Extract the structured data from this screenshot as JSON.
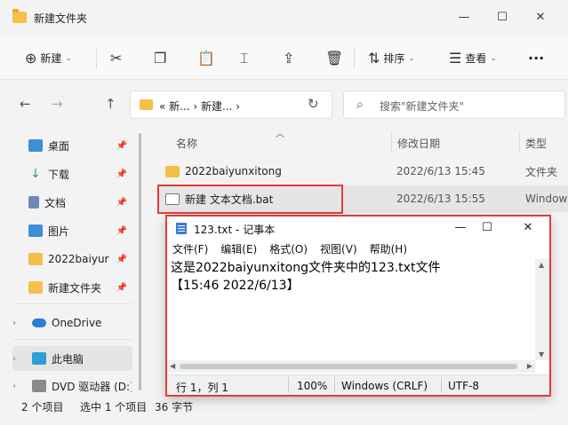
{
  "window": {
    "title": "新建文件夹",
    "minimize": "—",
    "maximize": "☐",
    "close": "✕"
  },
  "toolbar": {
    "new_label": "新建",
    "sort_label": "排序",
    "view_label": "查看",
    "more_label": "···"
  },
  "nav": {
    "back": "←",
    "forward": "→",
    "up": "↑",
    "address": "«  新...  ›  新建...  ›",
    "refresh": "↻",
    "search_placeholder": "搜索\"新建文件夹\""
  },
  "sidebar": {
    "items": [
      {
        "label": "桌面",
        "icon": "desktop-icon",
        "color": "#3c8fd6"
      },
      {
        "label": "下载",
        "icon": "download-icon",
        "color": "#2c9f6b"
      },
      {
        "label": "文档",
        "icon": "document-icon",
        "color": "#6f88b8"
      },
      {
        "label": "图片",
        "icon": "picture-icon",
        "color": "#3c8fd6"
      },
      {
        "label": "2022baiyur",
        "icon": "folder-icon",
        "color": "#f4c04a"
      },
      {
        "label": "新建文件夹",
        "icon": "folder-icon",
        "color": "#f4c04a"
      }
    ],
    "onedrive": "OneDrive",
    "thispc": "此电脑",
    "dvd": "DVD 驱动器 (D:)"
  },
  "filelist": {
    "columns": {
      "name": "名称",
      "date": "修改日期",
      "type": "类型"
    },
    "rows": [
      {
        "name": "2022baiyunxitong",
        "date": "2022/6/13 15:45",
        "type": "文件夹"
      },
      {
        "name": "新建 文本文档.bat",
        "date": "2022/6/13 15:55",
        "type": "Windows"
      }
    ]
  },
  "statusbar": {
    "count": "2 个项目",
    "selected": "选中 1 个项目",
    "size": "36 字节"
  },
  "notepad": {
    "title": "123.txt - 记事本",
    "menu": [
      "文件(F)",
      "编辑(E)",
      "格式(O)",
      "视图(V)",
      "帮助(H)"
    ],
    "line1": "这是2022baiyunxitong文件夹中的123.txt文件",
    "line2": "【15:46 2022/6/13】",
    "status": {
      "position": "行 1，列 1",
      "zoom": "100%",
      "eol": "Windows (CRLF)",
      "encoding": "UTF-8"
    }
  },
  "colors": {
    "highlight": "#e23b3b",
    "accent": "#3c7ad6",
    "folder": "#f4c04a"
  }
}
